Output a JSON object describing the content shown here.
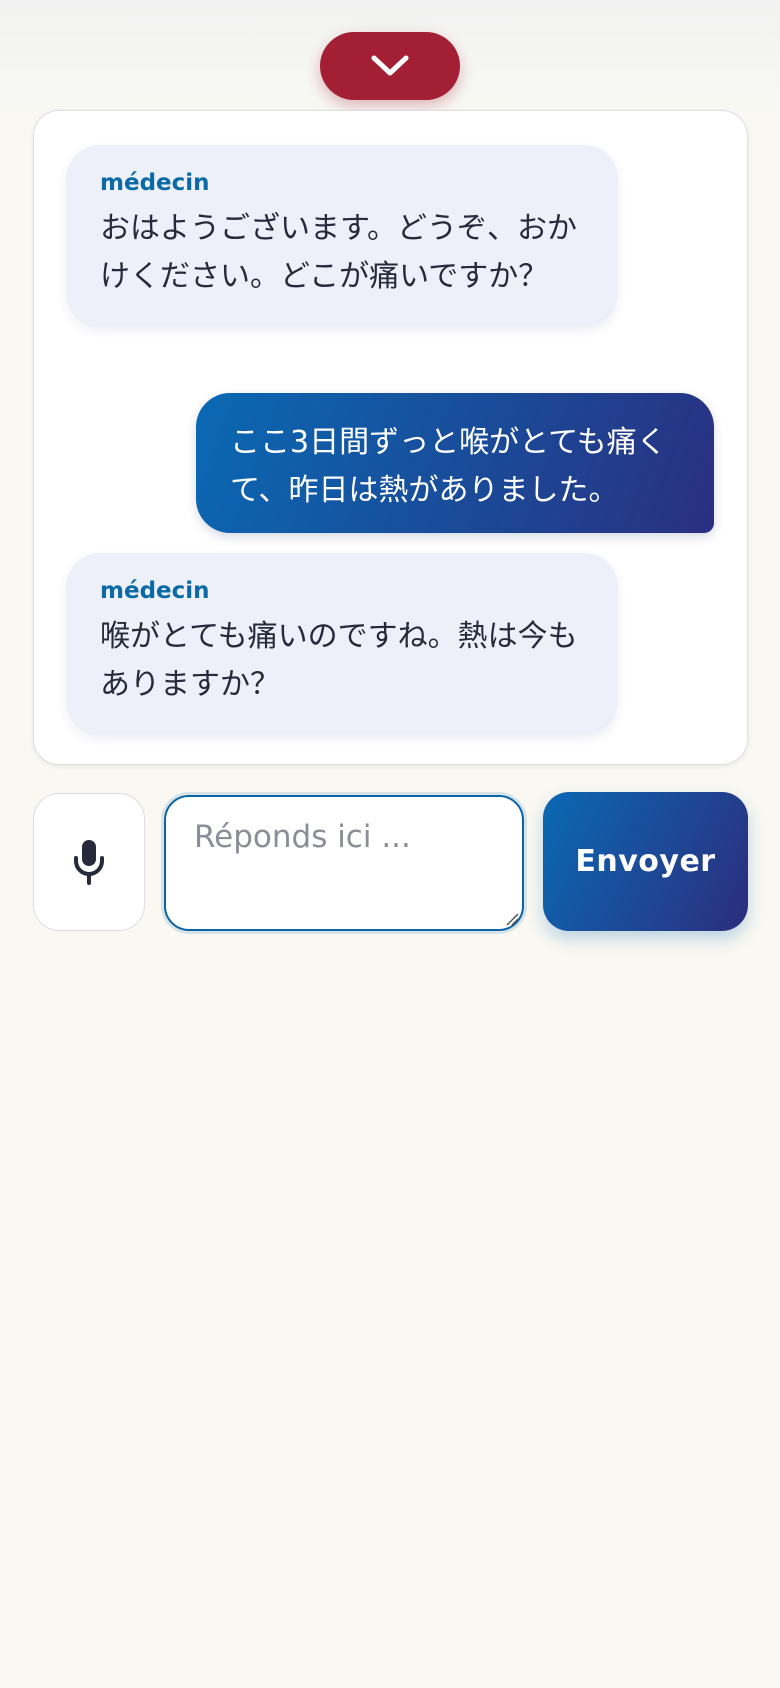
{
  "header": {
    "collapse_icon": "chevron-down-icon"
  },
  "colors": {
    "accent_red": "#a31f34",
    "accent_blue": "#0a69b3",
    "speaker_label": "#0a6aa6"
  },
  "chat": {
    "messages": [
      {
        "role": "bot",
        "speaker": "médecin",
        "text": "おはようございます。どうぞ、おかけください。どこが痛いですか？"
      },
      {
        "role": "user",
        "text": "ここ3日間ずっと喉がとても痛くて、昨日は熱がありました。"
      },
      {
        "role": "bot",
        "speaker": "médecin",
        "text": "喉がとても痛いのですね。熱は今もありますか？"
      }
    ]
  },
  "composer": {
    "mic_icon": "microphone-icon",
    "placeholder": "Réponds ici ...",
    "value": "",
    "send_label": "Envoyer"
  }
}
